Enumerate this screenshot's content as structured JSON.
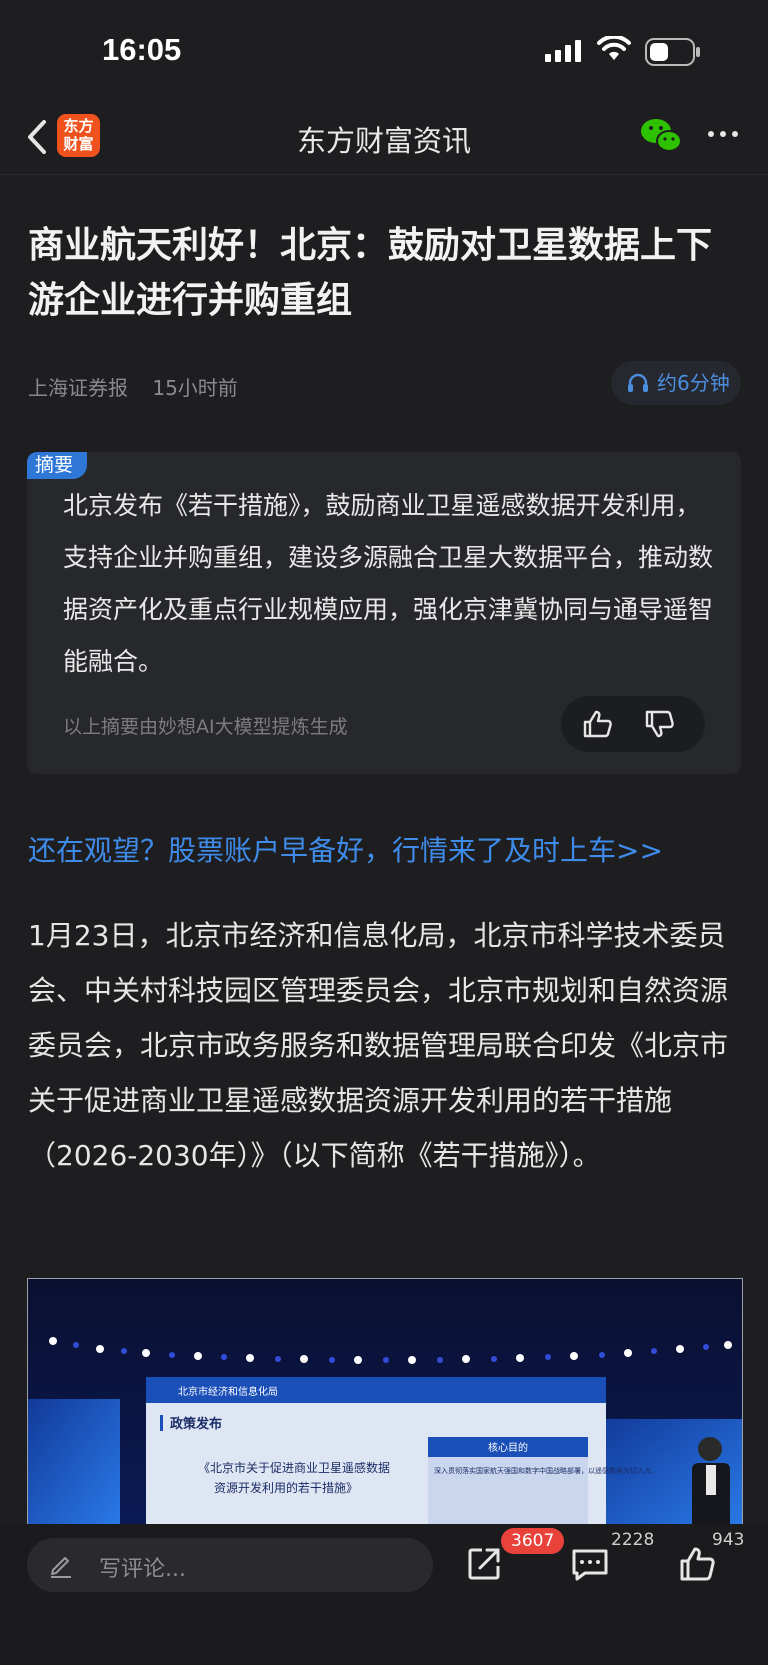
{
  "status_bar": {
    "time": "16:05"
  },
  "nav": {
    "logo_text_line1": "东方",
    "logo_text_line2": "财富",
    "title": "东方财富资讯"
  },
  "article": {
    "title": "商业航天利好！北京：鼓励对卫星数据上下游企业进行并购重组",
    "source": "上海证券报",
    "time_ago": "15小时前",
    "read_time": "约6分钟",
    "summary": {
      "tag": "摘要",
      "text": "北京发布《若干措施》，鼓励商业卫星遥感数据开发利用，支持企业并购重组，建设多源融合卫星大数据平台，推动数据资产化及重点行业规模应用，强化京津冀协同与通导遥智能融合。",
      "note": "以上摘要由妙想AI大模型提炼生成"
    },
    "promo_link": "还在观望？股票账户早备好，行情来了及时上车>>",
    "paragraph": "1月23日，北京市经济和信息化局，北京市科学技术委员会、中关村科技园区管理委员会，北京市规划和自然资源委员会，北京市政务服务和数据管理局联合印发《北京市关于促进商业卫星遥感数据资源开发利用的若干措施（2026-2030年）》（以下简称《若干措施》）。",
    "image": {
      "agency": "北京市经济和信息化局",
      "section": "政策发布",
      "slide_title_line1": "《北京市关于促进商业卫星遥感数据",
      "slide_title_line2": "资源开发利用的若干措施》",
      "box_title": "核心目的",
      "box_text": "深入贯彻落实国家航天强国和数字中国战略部署，以遥感数据为切入点，"
    }
  },
  "bottom_bar": {
    "comment_placeholder": "写评论...",
    "share_count": "3607",
    "comment_count": "2228",
    "like_count": "943"
  },
  "colors": {
    "background": "#1e1e20",
    "accent_blue": "#3f8bea",
    "badge_red": "#e9423a",
    "logo_orange": "#f0521e",
    "wechat_green": "#2dc100"
  }
}
